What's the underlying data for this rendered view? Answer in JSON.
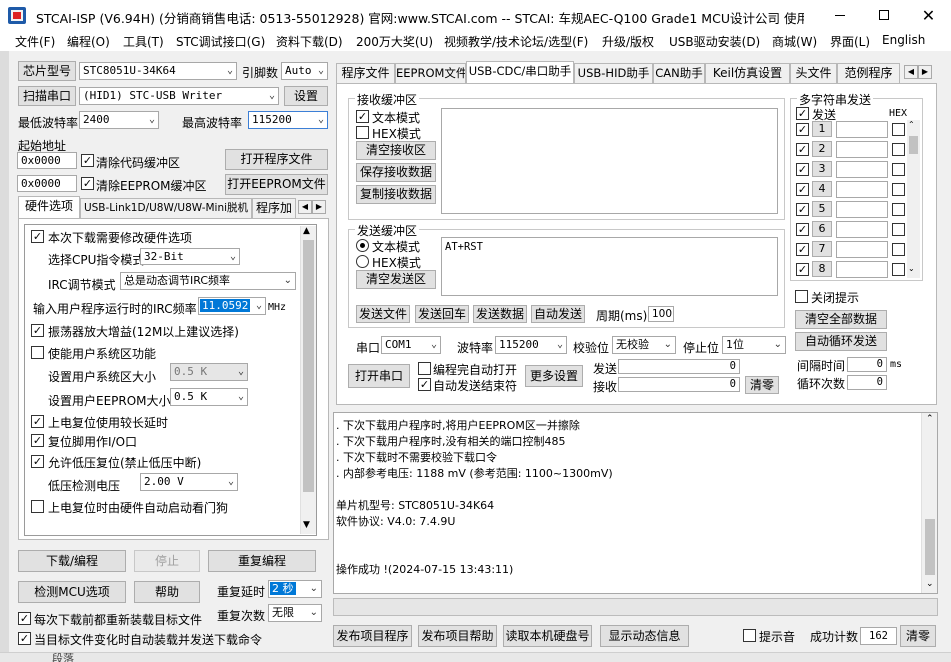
{
  "window": {
    "title": "STCAI-ISP (V6.94H) (分销商销售电话: 0513-55012928) 官网:www.STCAI.com  -- STCAI: 车规AEC-Q100 Grade1 MCU设计公司 使用本司..."
  },
  "menu": [
    "文件(F)",
    "编程(O)",
    "工具(T)",
    "STC调试接口(G)",
    "资料下载(D)",
    "200万大奖(U)",
    "视频教学/技术论坛/选型(F)",
    "升级/版权",
    "USB驱动安装(D)",
    "商城(W)",
    "界面(L)",
    "English"
  ],
  "left": {
    "chip_label": "芯片型号",
    "chip_value": "STC8051U-34K64",
    "pins_label": "引脚数",
    "pins_value": "Auto",
    "scan_label": "扫描串口",
    "port_value": "(HID1) STC-USB Writer",
    "settings_label": "设置",
    "min_baud_label": "最低波特率",
    "min_baud_value": "2400",
    "max_baud_label": "最高波特率",
    "max_baud_value": "115200",
    "start_addr_label": "起始地址",
    "addr1": "0x0000",
    "clear_code_label": "清除代码缓冲区",
    "open_prog_label": "打开程序文件",
    "addr2": "0x0000",
    "clear_eeprom_label": "清除EEPROM缓冲区",
    "open_eeprom_label": "打开EEPROM文件",
    "tabs": [
      "硬件选项",
      "USB-Link1D/U8W/U8W-Mini脱机",
      "程序加"
    ],
    "hw": {
      "opt1": "本次下载需要修改硬件选项",
      "cpu_mode_label": "选择CPU指令模式",
      "cpu_mode_value": "32-Bit",
      "irc_label": "IRC调节模式",
      "irc_value": "总是动态调节IRC频率",
      "freq_label": "输入用户程序运行时的IRC频率",
      "freq_value": "11.0592",
      "freq_unit": "MHz",
      "opt_osc": "振荡器放大增益(12M以上建议选择)",
      "opt_sysarea": "使能用户系统区功能",
      "sysarea_label": "设置用户系统区大小",
      "sysarea_value": "0.5 K",
      "eeprom_size_label": "设置用户EEPROM大小",
      "eeprom_size_value": "0.5 K",
      "opt_reset_long": "上电复位使用较长延时",
      "opt_reset_io": "复位脚用作I/O口",
      "opt_lvr": "允许低压复位(禁止低压中断)",
      "lvd_label": "低压检测电压",
      "lvd_value": "2.00 V",
      "opt_wdt": "上电复位时由硬件自动启动看门狗"
    },
    "download_label": "下载/编程",
    "stop_label": "停止",
    "repeat_label": "重复编程",
    "detect_label": "检测MCU选项",
    "help_label": "帮助",
    "delay_label": "重复延时",
    "delay_value": "2 秒",
    "count_label": "重复次数",
    "count_value": "无限",
    "reload_label": "每次下载前都重新装载目标文件",
    "auto_send_label": "当目标文件变化时自动装载并发送下载命令"
  },
  "right_tabs": [
    "程序文件",
    "EEPROM文件",
    "USB-CDC/串口助手",
    "USB-HID助手",
    "CAN助手",
    "Keil仿真设置",
    "头文件",
    "范例程序"
  ],
  "serial": {
    "recv_title": "接收缓冲区",
    "recv_text": "文本模式",
    "recv_hex": "HEX模式",
    "clear_recv": "清空接收区",
    "save_recv": "保存接收数据",
    "copy_recv": "复制接收数据",
    "send_title": "发送缓冲区",
    "send_text": "文本模式",
    "send_hex": "HEX模式",
    "clear_send": "清空发送区",
    "send_content": "AT+RST",
    "send_file": "发送文件",
    "send_echo": "发送回车",
    "send_data": "发送数据",
    "auto_send": "自动发送",
    "period_label": "周期(ms)",
    "period_value": "100",
    "port_label": "串口",
    "port_value": "COM1",
    "baud_label": "波特率",
    "baud_value": "115200",
    "parity_label": "校验位",
    "parity_value": "无校验",
    "stop_label": "停止位",
    "stop_value": "1位",
    "open_label": "打开串口",
    "auto_open": "编程完自动打开",
    "auto_end": "自动发送结束符",
    "more": "更多设置",
    "tx_label": "发送",
    "tx_value": "0",
    "rx_label": "接收",
    "rx_value": "0",
    "clear_count": "清零"
  },
  "multi": {
    "title": "多字符串发送",
    "send_col": "发送",
    "hex_col": "HEX",
    "rows": [
      "1",
      "2",
      "3",
      "4",
      "5",
      "6",
      "7",
      "8"
    ],
    "close_tip": "关闭提示",
    "clear_all": "清空全部数据",
    "auto_loop": "自动循环发送",
    "interval_label": "间隔时间",
    "interval_value": "0",
    "interval_unit": "ms",
    "loop_label": "循环次数",
    "loop_value": "0"
  },
  "log": [
    ". 下次下载用户程序时,将用户EEPROM区一并擦除",
    ". 下次下载用户程序时,没有相关的端口控制485",
    ". 下次下载时不需要校验下载口令",
    ". 内部参考电压: 1188 mV (参考范围: 1100~1300mV)",
    "",
    "单片机型号: STC8051U-34K64",
    "软件协议: V4.0: 7.4.9U",
    "",
    "",
    "操作成功 !(2024-07-15 13:43:11)"
  ],
  "bottom": {
    "publish_prog": "发布项目程序",
    "publish_help": "发布项目帮助",
    "read_disk": "读取本机硬盘号",
    "show_dyn": "显示动态信息",
    "tip_sound": "提示音",
    "success_label": "成功计数",
    "success_value": "162",
    "clear": "清零"
  },
  "taskbar": {
    "item": "段落"
  }
}
